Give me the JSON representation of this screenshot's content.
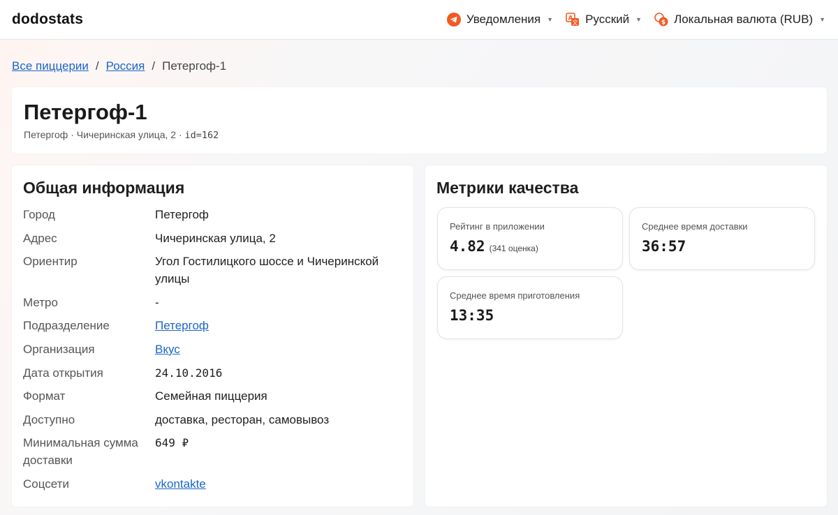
{
  "header": {
    "logo": "dodostats",
    "nav": [
      {
        "label": "Уведомления",
        "icon": "telegram-icon"
      },
      {
        "label": "Русский",
        "icon": "translate-icon"
      },
      {
        "label": "Локальная валюта (RUB)",
        "icon": "currency-icon"
      }
    ]
  },
  "breadcrumb": {
    "items": [
      "Все пиццерии",
      "Россия",
      "Петергоф-1"
    ],
    "separator": "/"
  },
  "pizzeria": {
    "title": "Петергоф-1",
    "subtitle": "Петергоф · Чичеринская улица, 2 · ",
    "id_text": "id=162"
  },
  "info": {
    "heading": "Общая информация",
    "rows": [
      {
        "key": "Город",
        "value": "Петергоф"
      },
      {
        "key": "Адрес",
        "value": "Чичеринская улица, 2"
      },
      {
        "key": "Ориентир",
        "value": "Угол Гостилицкого шоссе и Чичеринской улицы"
      },
      {
        "key": "Метро",
        "value": "-"
      },
      {
        "key": "Подразделение",
        "value": "Петергоф"
      },
      {
        "key": "Организация",
        "value": "Вкус"
      },
      {
        "key": "Дата открытия",
        "value": "24.10.2016"
      },
      {
        "key": "Формат",
        "value": "Семейная пиццерия"
      },
      {
        "key": "Доступно",
        "value": "доставка, ресторан, самовывоз"
      },
      {
        "key": "Минимальная сумма доставки",
        "value": "649 ₽"
      },
      {
        "key": "Соцсети",
        "value": "vkontakte"
      }
    ]
  },
  "metrics": {
    "heading": "Метрики качества",
    "items": [
      {
        "label": "Рейтинг в приложении",
        "value": "4.82",
        "note": "(341 оценка)"
      },
      {
        "label": "Среднее время доставки",
        "value": "36:57"
      },
      {
        "label": "Среднее время приготовления",
        "value": "13:35"
      }
    ]
  },
  "colors": {
    "link": "#1a66c9",
    "telegram": "#f15a22",
    "accent": "#f15a22"
  }
}
